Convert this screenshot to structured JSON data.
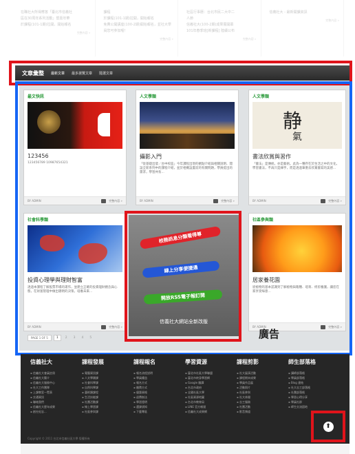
{
  "top_strip": [
    {
      "line1": "在職社大所得應答「臺北市信義社",
      "line2": "區在30周年系列活動」暨嘉年華",
      "line3": "於課程(101-1期)拉開，開始報名",
      "more": "完整內容 »"
    },
    {
      "line1": "課程",
      "line2": "於課程(101-1期)拉開，開始報名",
      "line3": "免費公開講座(100-2期)開始報名，並社大學員您可參加喔！",
      "more": "完整內容 »"
    },
    {
      "line1": "社區行事曆：台北市民二大中二",
      "line2": "人節",
      "line3": "信義社大(100-2期)成果展開幕",
      "line4": "101年春季班[新課程] 陸續公布",
      "more": "完整內容 »"
    },
    {
      "line1": "信義社大 - 最新開課資訊",
      "line2": "",
      "line3": "",
      "more": "完整內容 »"
    }
  ],
  "menu": {
    "title": "文章彙整",
    "items": [
      "最新文章",
      "最多瀏覽文章",
      "隨選文章"
    ]
  },
  "cards": [
    {
      "cat": "最文快訊",
      "title": "123456",
      "desc": "123456789 10987654321",
      "author": "BY ADMIN",
      "more": "完整內容 »"
    },
    {
      "cat": "人文學類",
      "title": "攝影入門",
      "desc": "「從基礎出發／台中校區」今年課程出現的觀點介紹與相關說明、開設全新系列中的課程介紹，並於相機設置前的有關問題，學員提出的需求，學習共有...",
      "author": "BY ADMIN",
      "more": "完整內容 »"
    },
    {
      "cat": "人文學類",
      "title": "書法欣賞與習作",
      "desc": "「書法」是傳統，亦是藝術。此為一種存在於生活之中的文化，學習書法，不再只是練字，而是透過筆墨去欣賞書寫的美感...",
      "author": "BY ADMIN",
      "more": "完整內容 »"
    },
    {
      "cat": "社會科學類",
      "title": "投資心理學與理財智富",
      "desc": "透過本課程了解股票市場的運作，並建立正確的投資理財觀念與心態，在財富管理中做出聰明的決策，培養未來...",
      "author": "BY ADMIN",
      "more": "完整內容 »"
    },
    {
      "cat": "社區參與類",
      "title": "居家養花園",
      "desc": "從植物的基本認識到了解植物與栽種、培育、修剪養護，讓您在家享受綠意...",
      "author": "BY ADMIN",
      "more": "完整內容 »"
    }
  ],
  "ad": {
    "ribbon1": "校務訊息分類看得尊",
    "ribbon2": "線上分享便捷通",
    "ribbon3": "開放RSS電子報訂閱",
    "caption": "信義社大網站全新改版",
    "label": "廣告"
  },
  "pager": {
    "info": "PAGE 1 OF 5",
    "pages": [
      "1",
      "2",
      "3",
      "4",
      "5"
    ]
  },
  "footer": {
    "columns": [
      {
        "title": "信義社大",
        "links": [
          "信義社大會員註冊",
          "信義社大簡介",
          "信義社大服務中心",
          "社大工作團隊",
          "上課教室一覽表",
          "交通資訊",
          "聯絡我們",
          "信義社大歷年成果",
          "創社紀念..."
        ]
      },
      {
        "title": "課程發展",
        "links": [
          "電腦資訊課",
          "人文學類課",
          "社會科學課",
          "自然科學課",
          "藝術類課程",
          "生活技能課",
          "社團活動課",
          "線上學習課",
          "社區參與課"
        ]
      },
      {
        "title": "課程報名",
        "links": [
          "報名流程說明",
          "學員權益",
          "報名方式",
          "繳費方式",
          "優惠資格",
          "退費辦法",
          "學習證明",
          "選課須知",
          "下載專區"
        ]
      },
      {
        "title": "學習資源",
        "links": [
          "臺北市社區大學聯盟",
          "臺北市終身學習網",
          "Google 翻譯",
          "台北市政府",
          "全國社區大學",
          "社區資源地圖",
          "台北市教育局",
          "LINE 官方帳號",
          "信義社大成果網"
        ]
      },
      {
        "title": "課程剪影",
        "links": [
          "社大展演活動",
          "課程期末成果",
          "學員作品展",
          "活動照片",
          "社區參與",
          "社大休閒",
          "志工服務",
          "社團活動",
          "影音頻道"
        ]
      },
      {
        "title": "師生部落格",
        "links": [
          "講師部落格",
          "學員部落格",
          "Blog 連結",
          "社大志工部落格",
          "社團部落格",
          "學習心得分享",
          "學員社群",
          "師生交流園地"
        ]
      }
    ],
    "copyright": "Copyright © 2011 台北市信義社區大學 版權所有",
    "up_symbol": "⬆"
  }
}
